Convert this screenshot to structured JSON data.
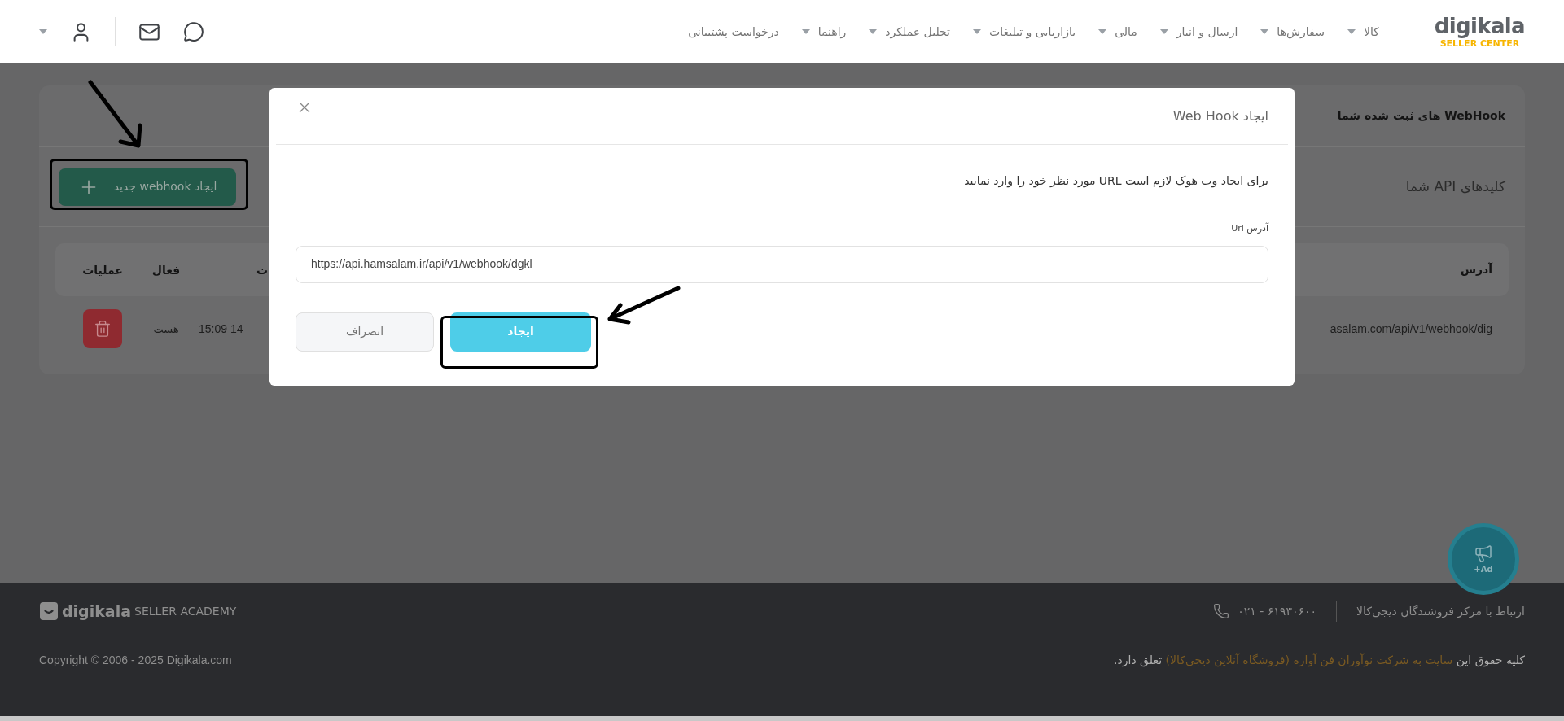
{
  "header": {
    "logo": {
      "name": "digikala",
      "subtitle": "SELLER CENTER"
    },
    "nav": [
      {
        "label": "کالا",
        "dropdown": true
      },
      {
        "label": "سفارش‌ها",
        "dropdown": true
      },
      {
        "label": "ارسال و انبار",
        "dropdown": true
      },
      {
        "label": "مالی",
        "dropdown": true
      },
      {
        "label": "بازاریابی و تبلیغات",
        "dropdown": true
      },
      {
        "label": "تحلیل عملکرد",
        "dropdown": true
      },
      {
        "label": "راهنما",
        "dropdown": true
      },
      {
        "label": "درخواست پشتیبانی",
        "dropdown": false
      }
    ]
  },
  "page": {
    "section_title": "WebHook های ثبت شده شما",
    "tab_label": "کلیدهای API شما",
    "new_button": "ایجاد webhook جدید",
    "table": {
      "columns": [
        "آدرس",
        "ت",
        "فعال",
        "عملیات"
      ],
      "rows": [
        {
          "address": "asalam.com/api/v1/webhook/dig",
          "date": "15:09 14",
          "active": "هست"
        }
      ]
    }
  },
  "modal": {
    "title": "ایجاد Web Hook",
    "message": "برای ایجاد وب هوک لازم است URL مورد نظر خود را وارد نمایید",
    "field_label": "آدرس Url",
    "field_value": "https://api.hamsalam.ir/api/v1/webhook/dgkl",
    "buttons": [
      {
        "label": "ایجاد",
        "kind": "primary"
      },
      {
        "label": "انصراف",
        "kind": "secondary"
      }
    ]
  },
  "ad_badge": "+Ad",
  "footer": {
    "contact": "ارتباط با مرکز فروشندگان دیجی‌کالا",
    "phone": "۰۲۱ - ۶۱۹۳۰۶۰۰",
    "logo": {
      "name": "digikala",
      "subtitle": "SELLER ACADEMY"
    },
    "rights": {
      "prefix": "کلیه حقوق این",
      "link": "سایت به شرکت نوآوران فن آوازه (فروشگاه آنلاین دیجی‌کالا)",
      "suffix": "تعلق دارد."
    },
    "copyright": "Copyright © 2006 - 2025 Digikala.com"
  }
}
